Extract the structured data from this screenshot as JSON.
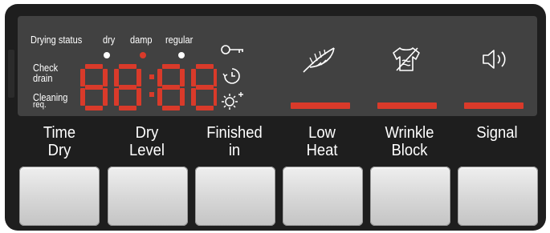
{
  "display": {
    "drying_status_label": "Drying status",
    "levels": [
      "dry",
      "damp",
      "regular"
    ],
    "check_drain": [
      "Check",
      "drain"
    ],
    "cleaning_req": [
      "Cleaning",
      "req."
    ],
    "segment_readout": "88:88"
  },
  "colors": {
    "panel": "#1e1e1e",
    "display": "#414141",
    "segment_lit": "#d93a2a",
    "segment_dim": "#4a3a3a",
    "indicator_white": "#ffffff",
    "indicator_red": "#d93a2a"
  },
  "icons": [
    "key-icon",
    "timer-icon",
    "light-icon",
    "feather-icon",
    "shirt-icon",
    "speaker-icon"
  ],
  "buttons": [
    {
      "line1": "Time",
      "line2": "Dry"
    },
    {
      "line1": "Dry",
      "line2": "Level"
    },
    {
      "line1": "Finished",
      "line2": "in"
    },
    {
      "line1": "Low",
      "line2": "Heat"
    },
    {
      "line1": "Wrinkle",
      "line2": "Block"
    },
    {
      "line1": "Signal",
      "line2": ""
    }
  ]
}
